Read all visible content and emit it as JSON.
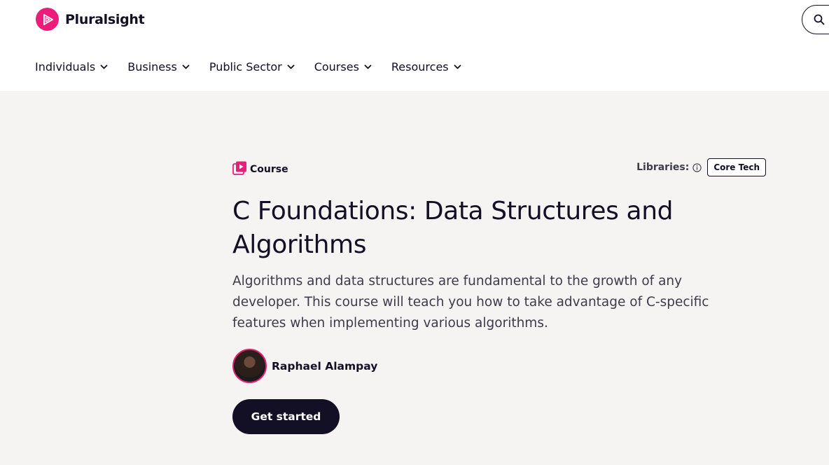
{
  "brand": {
    "name": "Pluralsight",
    "accent_color": "#ec1c7a",
    "logo_icon": "pluralsight-play-logo"
  },
  "nav": {
    "items": [
      {
        "label": "Individuals"
      },
      {
        "label": "Business"
      },
      {
        "label": "Public Sector"
      },
      {
        "label": "Courses"
      },
      {
        "label": "Resources"
      }
    ],
    "search_icon": "search-icon"
  },
  "course": {
    "type_label": "Course",
    "libraries_label": "Libraries:",
    "library_badge": "Core Tech",
    "title": "C Foundations: Data Structures and Algorithms",
    "description": "Algorithms and data structures are fundamental to the growth of any developer. This course will teach you how to take advantage of C-specific features when implementing various algorithms.",
    "author": "Raphael Alampay",
    "cta_label": "Get started"
  }
}
